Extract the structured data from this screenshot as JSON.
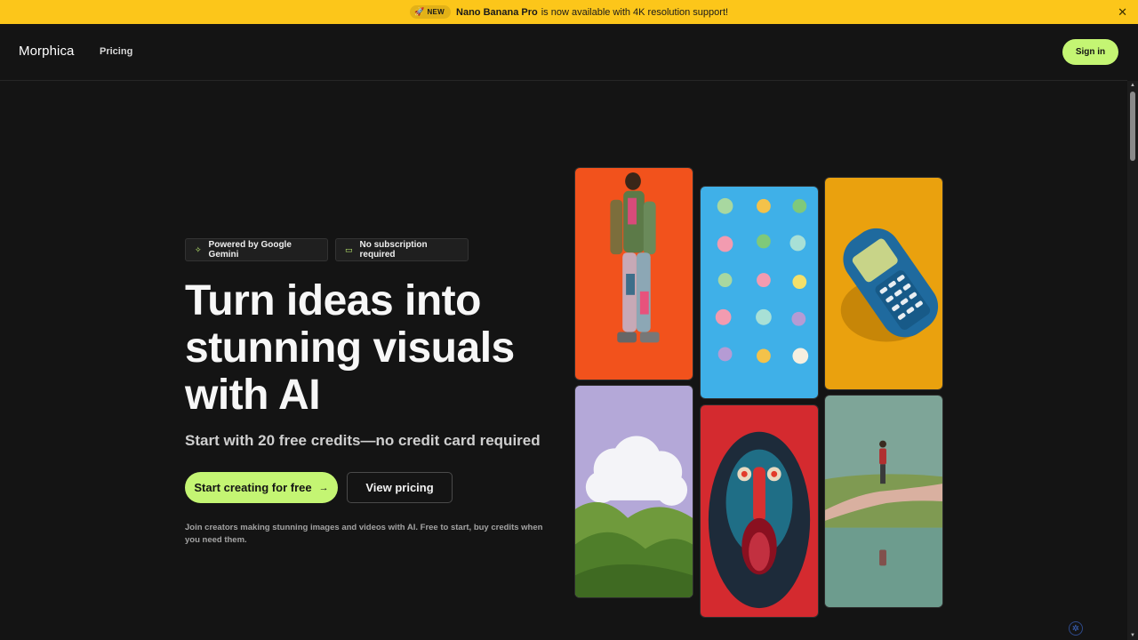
{
  "banner": {
    "pill_label": "NEW",
    "product": "Nano Banana Pro",
    "message": "is now available with 4K resolution support!",
    "close_glyph": "✕"
  },
  "nav": {
    "logo": "Morphica",
    "pricing": "Pricing",
    "signin": "Sign in"
  },
  "hero": {
    "badges": [
      {
        "label": "Powered by Google Gemini",
        "icon": "sparkle-icon"
      },
      {
        "label": "No subscription required",
        "icon": "card-icon"
      }
    ],
    "headline": "Turn ideas into stunning visuals with AI",
    "subheadline": "Start with 20 free credits—no credit card required",
    "cta_primary": "Start creating for free",
    "cta_secondary": "View pricing",
    "footnote": "Join creators making stunning images and videos with AI. Free to start, buy credits when you need them."
  },
  "gallery": [
    {
      "icon": "fashion-model-image"
    },
    {
      "icon": "macarons-image"
    },
    {
      "icon": "retro-phone-image"
    },
    {
      "icon": "cloud-hills-image"
    },
    {
      "icon": "mandrill-image"
    },
    {
      "icon": "reflection-path-image"
    }
  ],
  "colors": {
    "accent": "#c4f573",
    "banner": "#fcc61a",
    "background": "#141414"
  }
}
